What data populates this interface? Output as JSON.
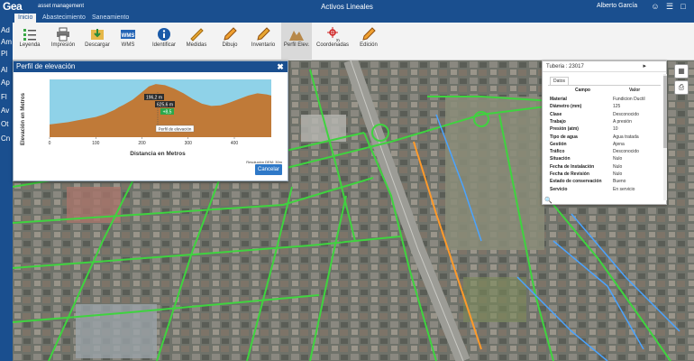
{
  "header": {
    "logo": "Gea",
    "logo_sub": "asset management",
    "title": "Activos Lineales",
    "user": "Alberto García"
  },
  "tabs": [
    {
      "label": "Inicio",
      "active": true
    },
    {
      "label": "Abastecimiento",
      "active": false
    },
    {
      "label": "Saneamiento",
      "active": false
    }
  ],
  "toolbar": {
    "items": [
      {
        "label": "Leyenda",
        "icon": "legend-icon"
      },
      {
        "label": "Impresión",
        "icon": "printer-icon"
      },
      {
        "label": "Descargar",
        "icon": "download-icon"
      },
      {
        "label": "WMS",
        "icon": "wms-icon"
      },
      {
        "label": "Identificar",
        "icon": "info-icon"
      },
      {
        "label": "Medidas",
        "icon": "ruler-icon"
      },
      {
        "label": "Dibujo",
        "icon": "pencil-icon"
      },
      {
        "label": "Inventario",
        "icon": "inventory-icon"
      },
      {
        "label": "Perfil Elev.",
        "icon": "elevation-icon"
      },
      {
        "label": "Coordenadas",
        "icon": "coordinates-icon"
      },
      {
        "label": "Edición",
        "icon": "edit-icon"
      }
    ]
  },
  "sidebar": {
    "items": [
      "Ad",
      "Am",
      "Pl",
      "Al",
      "Ap",
      "Fl",
      "Av",
      "Ot",
      "Cn"
    ]
  },
  "dialog": {
    "title": "Perfil de elevación",
    "ylabel": "Elevación en Metros",
    "xlabel": "Distancia en Metros",
    "tooltip_elevation": "196,2 m",
    "tooltip_distance": "625,6 m",
    "tooltip_delta": "+8,5",
    "tooltip_label": "Perfil de elevación",
    "resolution": "Resolución DEM: 30m",
    "cancel_label": "Cancelar"
  },
  "chart_data": {
    "type": "area",
    "title": "",
    "xlabel": "Distancia en Metros",
    "ylabel": "Elevación en Metros",
    "x_ticks": [
      "0",
      "100",
      "200",
      "300",
      "400"
    ],
    "xlim": [
      0,
      480
    ],
    "fill_color": "#c07a38",
    "sky_color": "#8fd2e8",
    "x": [
      0,
      20,
      40,
      60,
      80,
      100,
      120,
      140,
      150,
      160,
      180,
      200,
      215,
      230,
      250,
      270,
      290,
      310,
      330,
      350,
      370,
      390,
      410,
      430,
      450,
      470,
      480
    ],
    "y": [
      0.22,
      0.24,
      0.26,
      0.29,
      0.32,
      0.35,
      0.4,
      0.47,
      0.52,
      0.56,
      0.65,
      0.78,
      0.88,
      0.92,
      0.9,
      0.84,
      0.76,
      0.66,
      0.58,
      0.54,
      0.55,
      0.6,
      0.66,
      0.72,
      0.76,
      0.74,
      0.72
    ]
  },
  "info_panel": {
    "title": "Tuberia : 23017",
    "subtab": "Datos",
    "col_field": "Campo",
    "col_value": "Valor",
    "rows": [
      {
        "field": "Material",
        "value": "Fundicion Ductil"
      },
      {
        "field": "Diámetro (mm)",
        "value": "125"
      },
      {
        "field": "Clase",
        "value": "Desconocido"
      },
      {
        "field": "Trabajo",
        "value": "A presión"
      },
      {
        "field": "Presión (atm)",
        "value": "10"
      },
      {
        "field": "Tipo de agua",
        "value": "Agua tratada"
      },
      {
        "field": "Gestión",
        "value": "Ajena"
      },
      {
        "field": "Tráfico",
        "value": "Desconocido"
      },
      {
        "field": "Situación",
        "value": "Nulo"
      },
      {
        "field": "Fecha de Instalación",
        "value": "Nulo"
      },
      {
        "field": "Fecha de Revisión",
        "value": "Nulo"
      },
      {
        "field": "Estado de conservación",
        "value": "Bueno"
      },
      {
        "field": "Servicio",
        "value": "En servicio"
      }
    ]
  },
  "colors": {
    "brand": "#1a4f8f",
    "pipe_green": "#3fd33f",
    "pipe_blue": "#4aa3ff",
    "pipe_orange": "#ff9a2a"
  }
}
